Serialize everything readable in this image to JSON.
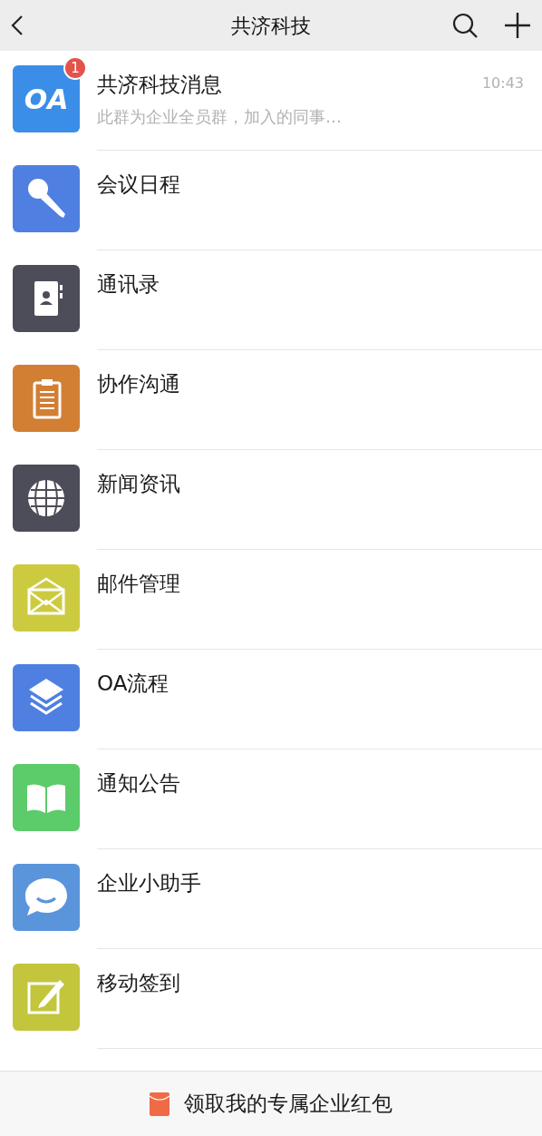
{
  "header": {
    "title": "共济科技"
  },
  "items": [
    {
      "kind": "oa",
      "title": "共济科技消息",
      "preview": "此群为企业全员群，加入的同事…",
      "time": "10:43",
      "badge": "1",
      "logo_text": "OA",
      "color": "#3b8ee8"
    },
    {
      "kind": "mic",
      "title": "会议日程",
      "color": "#4f80e1"
    },
    {
      "kind": "contacts",
      "title": "通讯录",
      "color": "#4d4d59"
    },
    {
      "kind": "clipboard",
      "title": "协作沟通",
      "color": "#d27f34"
    },
    {
      "kind": "globe",
      "title": "新闻资讯",
      "color": "#4d4d59"
    },
    {
      "kind": "mail",
      "title": "邮件管理",
      "color": "#cccb3f"
    },
    {
      "kind": "layers",
      "title": "OA流程",
      "color": "#4f80e1"
    },
    {
      "kind": "book",
      "title": "通知公告",
      "color": "#5ccb6a"
    },
    {
      "kind": "chat",
      "title": "企业小助手",
      "color": "#5a95dc"
    },
    {
      "kind": "edit",
      "title": "移动签到",
      "color": "#c3c53c"
    }
  ],
  "bottom_bar": {
    "label": "领取我的专属企业红包"
  }
}
